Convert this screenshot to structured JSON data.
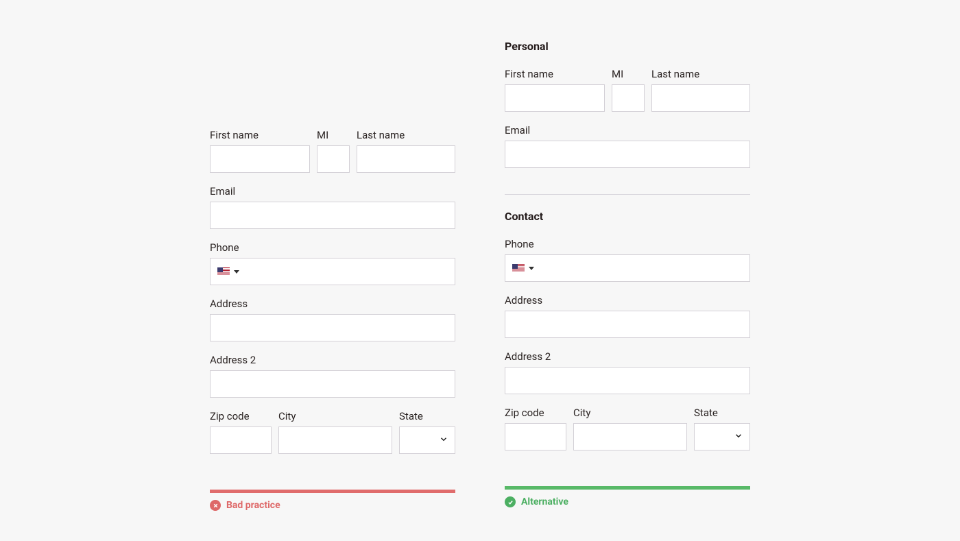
{
  "left": {
    "fields": {
      "first_name": "First name",
      "mi": "MI",
      "last_name": "Last name",
      "email": "Email",
      "phone": "Phone",
      "address": "Address",
      "address2": "Address 2",
      "zip": "Zip code",
      "city": "City",
      "state": "State"
    },
    "badge": "Bad practice"
  },
  "right": {
    "sections": {
      "personal": "Personal",
      "contact": "Contact"
    },
    "fields": {
      "first_name": "First name",
      "mi": "MI",
      "last_name": "Last name",
      "email": "Email",
      "phone": "Phone",
      "address": "Address",
      "address2": "Address 2",
      "zip": "Zip code",
      "city": "City",
      "state": "State"
    },
    "badge": "Alternative"
  }
}
